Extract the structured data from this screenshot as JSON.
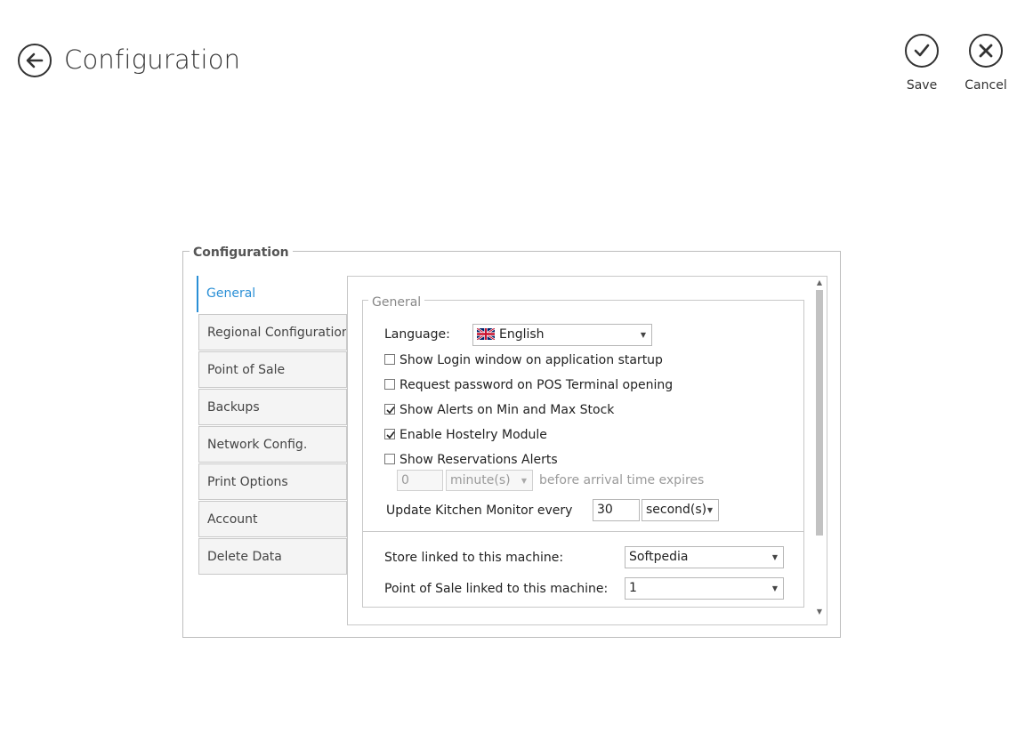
{
  "header": {
    "title": "Configuration",
    "save_label": "Save",
    "cancel_label": "Cancel"
  },
  "panel": {
    "legend": "Configuration"
  },
  "tabs": [
    {
      "label": "General",
      "active": true
    },
    {
      "label": "Regional Configuration",
      "active": false
    },
    {
      "label": "Point of Sale",
      "active": false
    },
    {
      "label": "Backups",
      "active": false
    },
    {
      "label": "Network Config.",
      "active": false
    },
    {
      "label": "Print Options",
      "active": false
    },
    {
      "label": "Account",
      "active": false
    },
    {
      "label": "Delete Data",
      "active": false
    }
  ],
  "general": {
    "legend": "General",
    "language_label": "Language:",
    "language_value": "English",
    "checkboxes": [
      {
        "label": "Show Login window on application startup",
        "checked": false
      },
      {
        "label": "Request password on POS Terminal opening",
        "checked": false
      },
      {
        "label": "Show Alerts on Min and Max Stock",
        "checked": true
      },
      {
        "label": "Enable Hostelry Module",
        "checked": true
      },
      {
        "label": "Show Reservations Alerts",
        "checked": false
      }
    ],
    "reservation_minutes_value": "0",
    "reservation_unit": "minute(s)",
    "reservation_suffix": "before arrival time expires",
    "kitchen_label": "Update Kitchen Monitor every",
    "kitchen_value": "30",
    "kitchen_unit": "second(s)",
    "store_label": "Store linked to this machine:",
    "store_value": "Softpedia",
    "pos_label": "Point of Sale linked to this machine:",
    "pos_value": "1"
  },
  "colors": {
    "accent": "#2a8fd6"
  },
  "icons": {
    "back": "arrow-left-circle-icon",
    "save": "check-circle-icon",
    "cancel": "x-circle-icon",
    "flag": "uk-flag-icon"
  }
}
